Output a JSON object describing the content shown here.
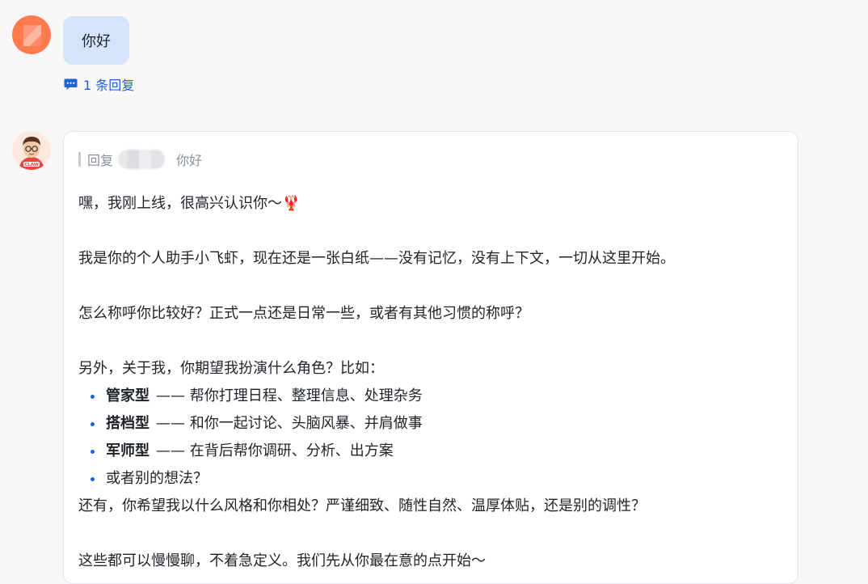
{
  "user_message": {
    "text": "你好",
    "reply_count_label": "1 条回复"
  },
  "bot_message": {
    "quote_prefix": "回复",
    "quote_text": "你好",
    "paragraphs": {
      "p1": "嘿，我刚上线，很高兴认识你～🦞",
      "p2": "我是你的个人助手小飞虾，现在还是一张白纸——没有记忆，没有上下文，一切从这里开始。",
      "p3": "怎么称呼你比较好？正式一点还是日常一些，或者有其他习惯的称呼？",
      "p4": "另外，关于我，你期望我扮演什么角色？比如：",
      "p5": "还有，你希望我以什么风格和你相处？严谨细致、随性自然、温厚体贴，还是别的调性？",
      "p6": "这些都可以慢慢聊，不着急定义。我们先从你最在意的点开始～"
    },
    "roles": [
      {
        "title": "管家型",
        "desc": "—— 帮你打理日程、整理信息、处理杂务"
      },
      {
        "title": "搭档型",
        "desc": "—— 和你一起讨论、头脑风暴、并肩做事"
      },
      {
        "title": "军师型",
        "desc": "—— 在背后帮你调研、分析、出方案"
      },
      {
        "title": "",
        "desc": "或者别的想法？"
      }
    ],
    "avatar_badge": "CLAW"
  },
  "colors": {
    "accent": "#1f62d8",
    "user_bubble": "#d5e4fb",
    "card_border": "#e3e5e8"
  },
  "icons": {
    "reply": "comment-bubble-icon"
  }
}
